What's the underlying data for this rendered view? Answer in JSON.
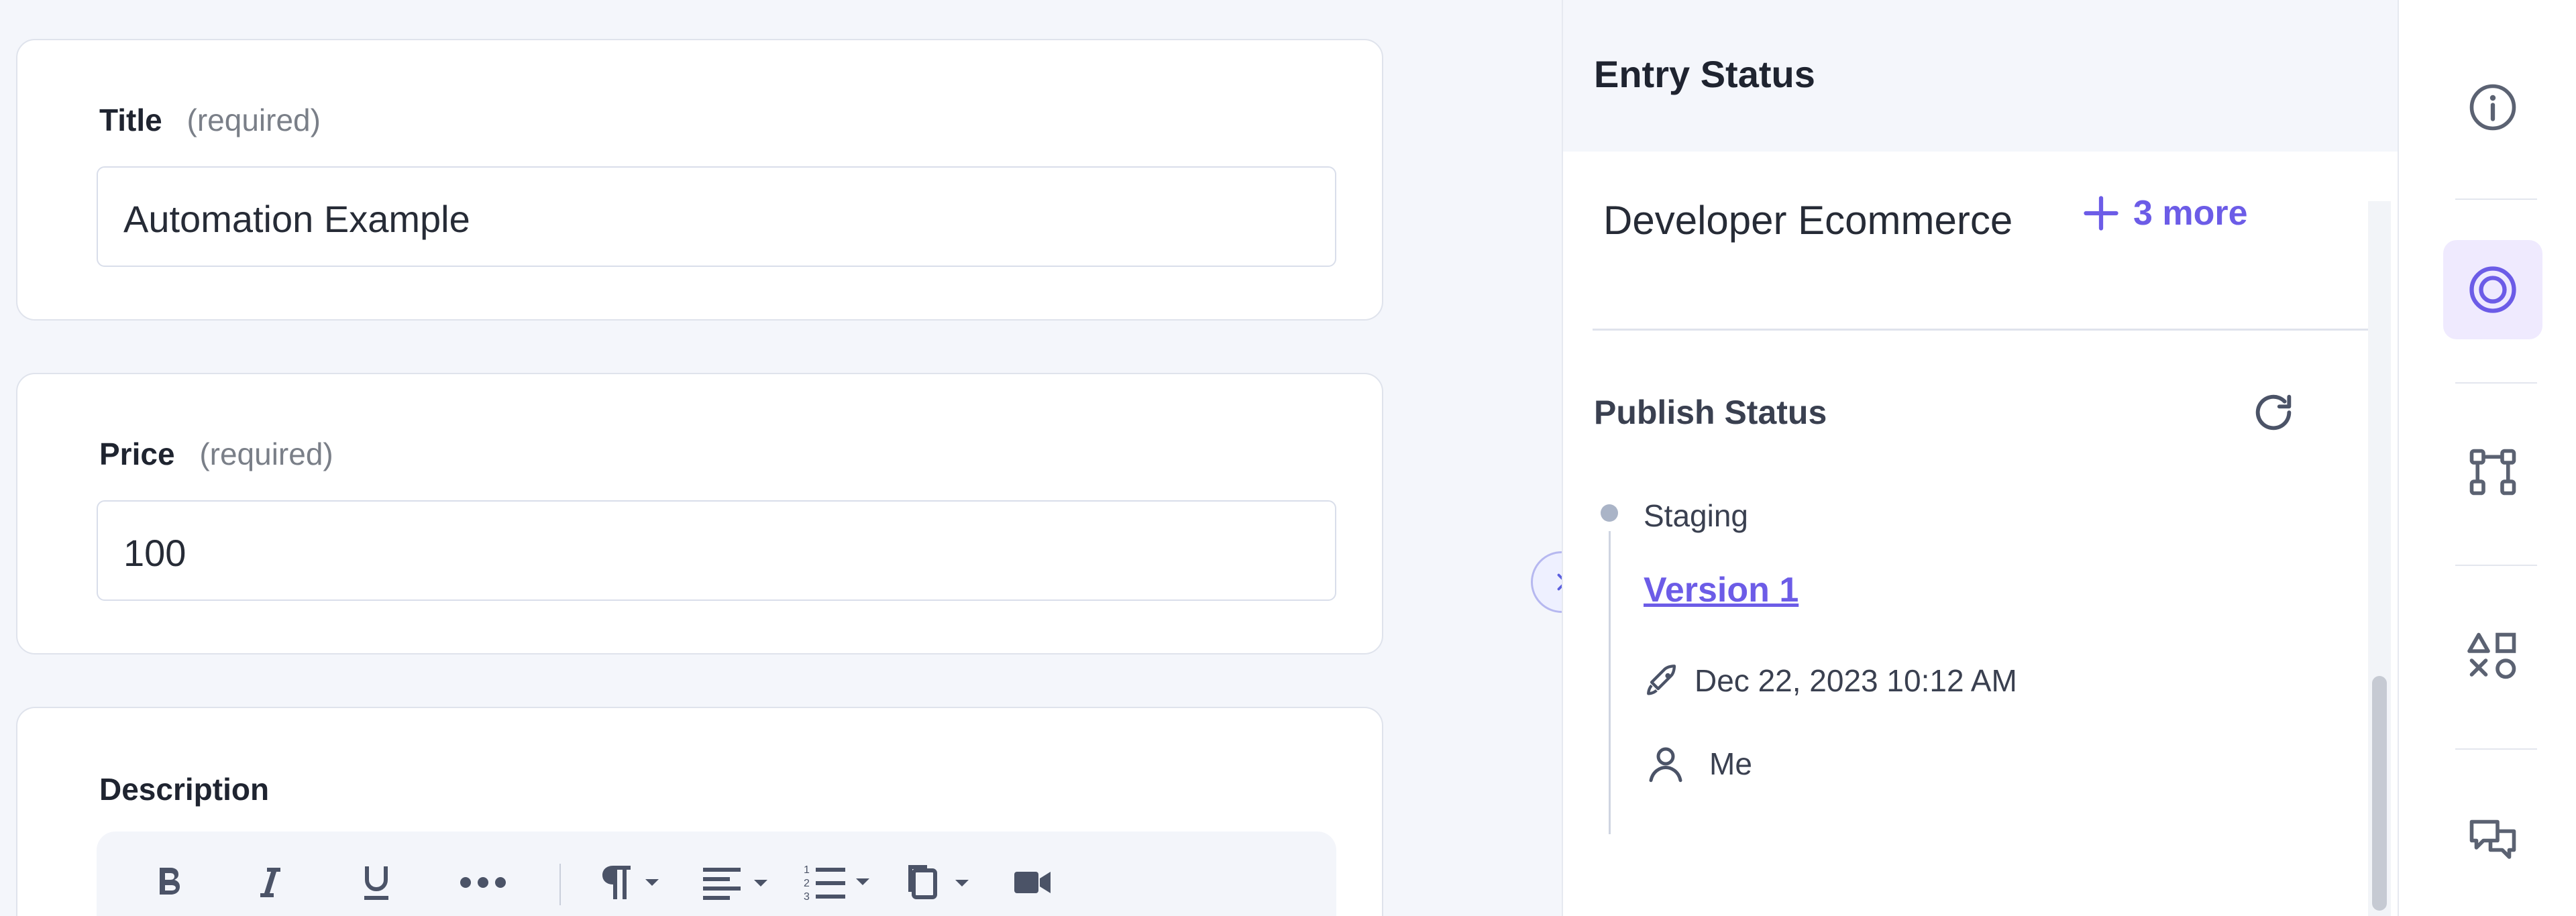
{
  "form": {
    "title": {
      "label": "Title",
      "required": "(required)",
      "value": "Automation Example"
    },
    "price": {
      "label": "Price",
      "required": "(required)",
      "value": "100"
    },
    "description": {
      "label": "Description"
    }
  },
  "right_panel": {
    "header": "Entry Status",
    "locale": {
      "name": "Developer Ecommerce",
      "more_label": "3 more"
    },
    "publish": {
      "title": "Publish Status",
      "environment": "Staging",
      "version": "Version 1",
      "date": "Dec 22, 2023 10:12 AM",
      "user": "Me"
    }
  },
  "icons": {
    "bold": "bold-icon",
    "italic": "italic-icon",
    "underline": "underline-icon",
    "more": "more-icon",
    "paragraph": "paragraph-icon",
    "align": "align-icon",
    "list": "list-icon",
    "copy": "copy-icon",
    "video": "video-icon",
    "info": "info-icon",
    "target": "target-icon",
    "workflow": "workflow-icon",
    "shapes": "shapes-icon",
    "chat": "chat-icon",
    "refresh": "refresh-icon",
    "rocket": "rocket-icon",
    "user": "user-icon",
    "chevron": "chevron-right-icon"
  },
  "colors": {
    "accent": "#6c5ce7",
    "background": "#f4f6fb"
  }
}
